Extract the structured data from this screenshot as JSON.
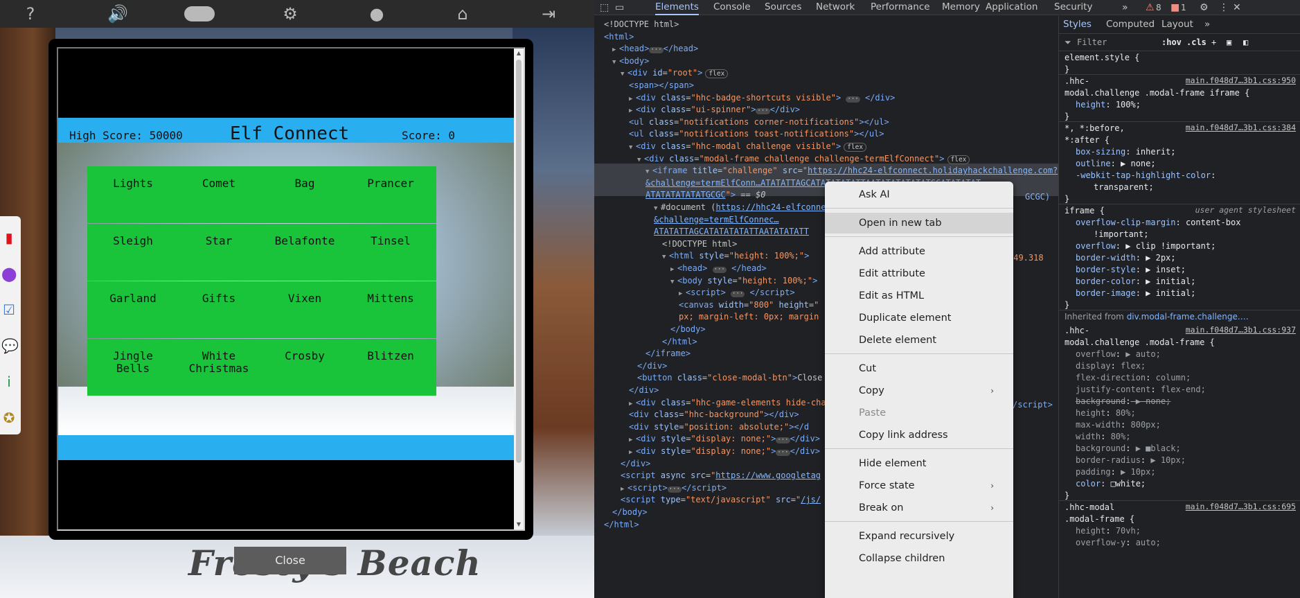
{
  "game": {
    "topbar_icons": [
      "help-icon",
      "volume-icon",
      "discord-icon",
      "settings-gear-icon",
      "user-icon",
      "home-icon",
      "logout-icon"
    ],
    "sidebar_icons": [
      "book-icon",
      "map-pin-icon",
      "checklist-icon",
      "chat-icon",
      "info-icon",
      "badge-icon"
    ],
    "hud": {
      "high_score": "High Score: 50000",
      "title": "Elf Connect",
      "score": "Score: 0"
    },
    "tiles": [
      "Lights",
      "Comet",
      "Bag",
      "Prancer",
      "Sleigh",
      "Star",
      "Belafonte",
      "Tinsel",
      "Garland",
      "Gifts",
      "Vixen",
      "Mittens",
      "Jingle\nBells",
      "White\nChristmas",
      "Crosby",
      "Blitzen"
    ],
    "close_label": "Close",
    "scene_title": "Frosty's Beach",
    "colors": {
      "tile": "#19c43a",
      "hud": "#29aef0"
    }
  },
  "devtools": {
    "tabs": [
      "Elements",
      "Console",
      "Sources",
      "Network",
      "Performance",
      "Memory",
      "Application",
      "Security"
    ],
    "more_tabs": "»",
    "warnings": "8",
    "errors": "1",
    "dom_lines": [
      {
        "indent": 0,
        "html": "&lt;!DOCTYPE html&gt;"
      },
      {
        "indent": 0,
        "html": "<span class='tag'>&lt;html&gt;</span>"
      },
      {
        "indent": 1,
        "html": "<span class='tri'>▶</span><span class='tag'>&lt;head&gt;</span><span class='dots'>···</span><span class='tag'>&lt;/head&gt;</span>"
      },
      {
        "indent": 1,
        "html": "<span class='tri'>▼</span><span class='tag'>&lt;body&gt;</span>"
      },
      {
        "indent": 2,
        "html": "<span class='tri'>▼</span><span class='tag'>&lt;div </span><span class='attr'>id</span>=<span class='val'>\"root\"</span><span class='tag'>&gt;</span><span class='pill'>flex</span>"
      },
      {
        "indent": 3,
        "html": "<span class='tag'>&lt;span&gt;&lt;/span&gt;</span>"
      },
      {
        "indent": 3,
        "html": "<span class='tri'>▶</span><span class='tag'>&lt;div </span><span class='attr'>class</span>=<span class='val'>\"hhc-badge-shortcuts visible\"</span><span class='tag'>&gt;</span> <span class='dots'>···</span> <span class='tag'>&lt;/div&gt;</span>"
      },
      {
        "indent": 3,
        "html": "<span class='tri'>▶</span><span class='tag'>&lt;div </span><span class='attr'>class</span>=<span class='val'>\"ui-spinner\"</span><span class='tag'>&gt;</span><span class='dots'>···</span><span class='tag'>&lt;/div&gt;</span>"
      },
      {
        "indent": 3,
        "html": "<span class='tag'>&lt;ul </span><span class='attr'>class</span>=<span class='val'>\"notifications corner-notifications\"</span><span class='tag'>&gt;&lt;/ul&gt;</span>"
      },
      {
        "indent": 3,
        "html": "<span class='tag'>&lt;ul </span><span class='attr'>class</span>=<span class='val'>\"notifications toast-notifications\"</span><span class='tag'>&gt;&lt;/ul&gt;</span>"
      },
      {
        "indent": 3,
        "html": "<span class='tri'>▼</span><span class='tag'>&lt;div </span><span class='attr'>class</span>=<span class='val'>\"hhc-modal challenge visible\"</span><span class='tag'>&gt;</span><span class='pill'>flex</span>"
      },
      {
        "indent": 4,
        "html": "<span class='tri'>▼</span><span class='tag'>&lt;div </span><span class='attr'>class</span>=<span class='val'>\"modal-frame challenge challenge-termElfConnect\"</span><span class='tag'>&gt;</span><span class='pill'>flex</span>"
      },
      {
        "indent": 5,
        "html": "<span class='tri'>▼</span><span class='tag'>&lt;iframe </span><span class='attr'>title</span>=<span class='val'>\"challenge\"</span> <span class='attr'>src</span>=<span class='val'>\"</span><span class='link'>https://hhc24-elfconnect.holidayhackchallenge.com?</span>"
      },
      {
        "indent": 5,
        "html": "<span class='link'>&amp;challenge=termElfConn…ATATATTAGCATATATATATTAATATATATATATGCATATATAT</span>"
      },
      {
        "indent": 5,
        "html": "<span class='link'>ATATATATATATGCGC</span><span class='val'>\"</span><span class='tag'>&gt;</span> == <i>$0</i>"
      },
      {
        "indent": 6,
        "html": "<span class='tri'>▼</span>#document (<span class='link'>https://hhc24-elfconnec</span>"
      },
      {
        "indent": 6,
        "html": "<span class='link'>&amp;challenge=termElfConnec…</span>"
      },
      {
        "indent": 6,
        "html": "<span class='link'>ATATATTAGCATATATATATTAATATATATT</span>"
      },
      {
        "indent": 7,
        "html": "&lt;!DOCTYPE html&gt;"
      },
      {
        "indent": 7,
        "html": "<span class='tri'>▼</span><span class='tag'>&lt;html </span><span class='attr'>style</span>=<span class='val'>\"height: 100%;\"</span><span class='tag'>&gt;</span>"
      },
      {
        "indent": 8,
        "html": "<span class='tri'>▶</span><span class='tag'>&lt;head&gt;</span> <span class='dots'>···</span> <span class='tag'>&lt;/head&gt;</span>"
      },
      {
        "indent": 8,
        "html": "<span class='tri'>▼</span><span class='tag'>&lt;body </span><span class='attr'>style</span>=<span class='val'>\"height: 100%;\"</span><span class='tag'>&gt;</span>"
      },
      {
        "indent": 9,
        "html": "<span class='tri'>▶</span><span class='tag'>&lt;script&gt;</span> <span class='dots'>···</span> <span class='tag'>&lt;/script&gt;</span>"
      },
      {
        "indent": 9,
        "html": "<span class='tag'>&lt;canvas </span><span class='attr'>width</span>=<span class='val'>\"800\"</span> <span class='attr'>height</span>=<span class='val'>\"</span>"
      },
      {
        "indent": 9,
        "html": "<span class='val'>px; margin-left: 0px; margin</span>"
      },
      {
        "indent": 8,
        "html": "<span class='tag'>&lt;/body&gt;</span>"
      },
      {
        "indent": 7,
        "html": "<span class='tag'>&lt;/html&gt;</span>"
      },
      {
        "indent": 5,
        "html": "<span class='tag'>&lt;/iframe&gt;</span>"
      },
      {
        "indent": 4,
        "html": "<span class='tag'>&lt;/div&gt;</span>"
      },
      {
        "indent": 4,
        "html": "<span class='tag'>&lt;button </span><span class='attr'>class</span>=<span class='val'>\"close-modal-btn\"</span><span class='tag'>&gt;</span>Close"
      },
      {
        "indent": 3,
        "html": "<span class='tag'>&lt;/div&gt;</span>"
      },
      {
        "indent": 3,
        "html": "<span class='tri'>▶</span><span class='tag'>&lt;div </span><span class='attr'>class</span>=<span class='val'>\"hhc-game-elements hide-cha</span>"
      },
      {
        "indent": 3,
        "html": "<span class='tag'>&lt;div </span><span class='attr'>class</span>=<span class='val'>\"hhc-background\"</span><span class='tag'>&gt;&lt;/div&gt;</span>"
      },
      {
        "indent": 3,
        "html": "<span class='tag'>&lt;div </span><span class='attr'>style</span>=<span class='val'>\"position: absolute;\"</span><span class='tag'>&gt;&lt;/d</span>"
      },
      {
        "indent": 3,
        "html": "<span class='tri'>▶</span><span class='tag'>&lt;div </span><span class='attr'>style</span>=<span class='val'>\"display: none;\"</span><span class='tag'>&gt;</span><span class='dots'>···</span><span class='tag'>&lt;/div&gt;</span>"
      },
      {
        "indent": 3,
        "html": "<span class='tri'>▶</span><span class='tag'>&lt;div </span><span class='attr'>style</span>=<span class='val'>\"display: none;\"</span><span class='tag'>&gt;</span><span class='dots'>···</span><span class='tag'>&lt;/div&gt;</span>"
      },
      {
        "indent": 2,
        "html": "<span class='tag'>&lt;/div&gt;</span>"
      },
      {
        "indent": 2,
        "html": "<span class='tag'>&lt;script </span><span class='attr'>async src</span>=<span class='val'>\"</span><span class='link'>https://www.googletag</span>"
      },
      {
        "indent": 2,
        "html": "<span class='tri'>▶</span><span class='tag'>&lt;script&gt;</span><span class='dots'>···</span><span class='tag'>&lt;/script&gt;</span>"
      },
      {
        "indent": 2,
        "html": "<span class='tag'>&lt;script </span><span class='attr'>type</span>=<span class='val'>\"text/javascript\"</span> <span class='attr'>src</span>=<span class='val'>\"</span><span class='link'>/js/</span>"
      },
      {
        "indent": 1,
        "html": "<span class='tag'>&lt;/body&gt;</span>"
      },
      {
        "indent": 0,
        "html": "<span class='tag'>&lt;/html&gt;</span>"
      }
    ],
    "dom_overflow_fragments": {
      "canvas_height": "449.318",
      "doc_end": "GCGC)",
      "script_end": "/script>"
    },
    "styles": {
      "tabs": [
        "Styles",
        "Computed",
        "Layout"
      ],
      "filter_placeholder": "Filter",
      "hov": ":hov",
      "cls": ".cls",
      "rules": [
        {
          "kind": "selector",
          "text": "element.style {"
        },
        {
          "kind": "close",
          "text": "}"
        },
        {
          "kind": "selector",
          "text": ".hhc-",
          "src": "main.f048d7…3b1.css:950"
        },
        {
          "kind": "selector",
          "text": "modal.challenge .modal-frame iframe {"
        },
        {
          "kind": "prop",
          "name": "height",
          "value": "100%;"
        },
        {
          "kind": "close",
          "text": "}"
        },
        {
          "kind": "selector",
          "text": "*, *:before,",
          "src": "main.f048d7…3b1.css:384"
        },
        {
          "kind": "selector",
          "text": "*:after {"
        },
        {
          "kind": "prop",
          "name": "box-sizing",
          "value": "inherit;"
        },
        {
          "kind": "prop",
          "name": "outline",
          "value": "▶ none;"
        },
        {
          "kind": "prop",
          "name": "-webkit-tap-highlight-color",
          "value": ""
        },
        {
          "kind": "value",
          "text": "transparent;"
        },
        {
          "kind": "close",
          "text": "}"
        },
        {
          "kind": "selector",
          "text": "iframe {",
          "src2": "user agent stylesheet"
        },
        {
          "kind": "prop",
          "name": "overflow-clip-margin",
          "value": "content-box"
        },
        {
          "kind": "value",
          "text": "!important;"
        },
        {
          "kind": "prop",
          "name": "overflow",
          "value": "▶ clip !important;"
        },
        {
          "kind": "prop",
          "name": "border-width",
          "value": "▶ 2px;"
        },
        {
          "kind": "prop",
          "name": "border-style",
          "value": "▶ inset;"
        },
        {
          "kind": "prop",
          "name": "border-color",
          "value": "▶ initial;"
        },
        {
          "kind": "prop",
          "name": "border-image",
          "value": "▶ initial;"
        },
        {
          "kind": "close",
          "text": "}"
        },
        {
          "kind": "inherited",
          "text": "Inherited from",
          "link": "div.modal-frame.challenge.…"
        },
        {
          "kind": "selector",
          "text": ".hhc-",
          "src": "main.f048d7…3b1.css:937"
        },
        {
          "kind": "selector",
          "text": "modal.challenge .modal-frame {"
        },
        {
          "kind": "dimprop",
          "name": "overflow",
          "value": "▶ auto;"
        },
        {
          "kind": "dimprop",
          "name": "display",
          "value": "flex;"
        },
        {
          "kind": "dimprop",
          "name": "flex-direction",
          "value": "column;"
        },
        {
          "kind": "dimprop",
          "name": "justify-content",
          "value": "flex-end;"
        },
        {
          "kind": "strike",
          "name": "background",
          "value": "▶ none;"
        },
        {
          "kind": "dimprop",
          "name": "height",
          "value": "80%;"
        },
        {
          "kind": "dimprop",
          "name": "max-width",
          "value": "800px;"
        },
        {
          "kind": "dimprop",
          "name": "width",
          "value": "80%;"
        },
        {
          "kind": "dimprop",
          "name": "background",
          "value": "▶ ■black;"
        },
        {
          "kind": "dimprop",
          "name": "border-radius",
          "value": "▶ 10px;"
        },
        {
          "kind": "dimprop",
          "name": "padding",
          "value": "▶ 10px;"
        },
        {
          "kind": "prop",
          "name": "color",
          "value": "□white;"
        },
        {
          "kind": "close",
          "text": "}"
        },
        {
          "kind": "selector",
          "text": ".hhc-modal",
          "src": "main.f048d7…3b1.css:695"
        },
        {
          "kind": "selector",
          "text": ".modal-frame {"
        },
        {
          "kind": "dimprop",
          "name": "height",
          "value": "70vh;"
        },
        {
          "kind": "dimprop",
          "name": "overflow-y",
          "value": "auto;"
        }
      ]
    }
  },
  "context_menu": {
    "items": [
      {
        "label": "Ask AI",
        "sep_after": true
      },
      {
        "label": "Open in new tab",
        "highlight": true,
        "sep_after": true
      },
      {
        "label": "Add attribute"
      },
      {
        "label": "Edit attribute"
      },
      {
        "label": "Edit as HTML"
      },
      {
        "label": "Duplicate element"
      },
      {
        "label": "Delete element",
        "sep_after": true
      },
      {
        "label": "Cut"
      },
      {
        "label": "Copy",
        "submenu": true
      },
      {
        "label": "Paste",
        "disabled": true
      },
      {
        "label": "Copy link address",
        "sep_after": true
      },
      {
        "label": "Hide element"
      },
      {
        "label": "Force state",
        "submenu": true
      },
      {
        "label": "Break on",
        "submenu": true,
        "sep_after": true
      },
      {
        "label": "Expand recursively"
      },
      {
        "label": "Collapse children"
      }
    ]
  }
}
